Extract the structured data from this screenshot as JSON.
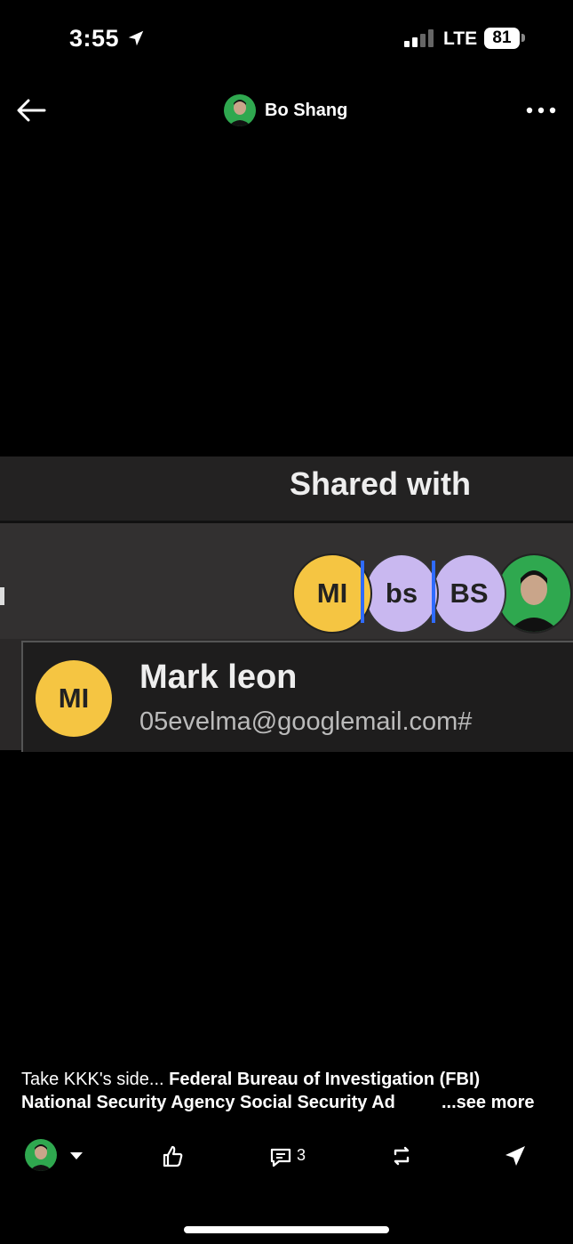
{
  "status_bar": {
    "time": "3:55",
    "network": "LTE",
    "battery": "81"
  },
  "header": {
    "user_name": "Bo Shang"
  },
  "image": {
    "shared_title": "Shared with",
    "avatars": [
      "MI",
      "bs",
      "BS"
    ],
    "card": {
      "initials": "MI",
      "name": "Mark leon",
      "email": "05evelma@googlemail.com#"
    }
  },
  "caption": {
    "lead": "Take KKK's side... ",
    "bold_text": "Federal Bureau of Investigation (FBI) National Security Agency Social Security Ad",
    "see_more": "...see more"
  },
  "actions": {
    "comment_count": "3"
  },
  "colors": {
    "accent_green": "#2fa84f",
    "avatar_yellow": "#f5c542",
    "avatar_lavender": "#c9b8f0",
    "selection_blue": "#2f6bff"
  }
}
